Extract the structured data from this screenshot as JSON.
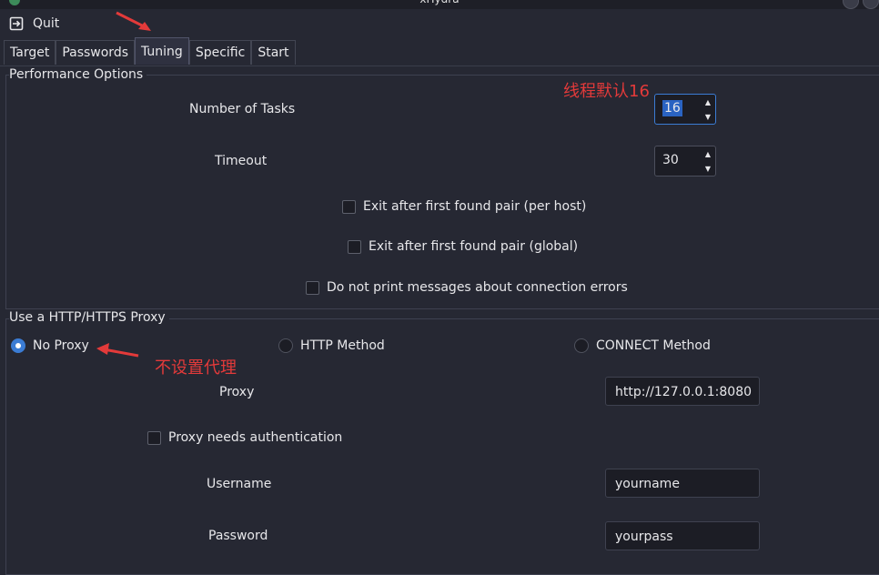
{
  "window": {
    "title": "xHydra"
  },
  "menu": {
    "quit_label": "Quit"
  },
  "tabs": [
    {
      "label": "Target"
    },
    {
      "label": "Passwords"
    },
    {
      "label": "Tuning"
    },
    {
      "label": "Specific"
    },
    {
      "label": "Start"
    }
  ],
  "performance": {
    "group_title": "Performance Options",
    "tasks_label": "Number of Tasks",
    "tasks_value": "16",
    "timeout_label": "Timeout",
    "timeout_value": "30",
    "exit_host_label": "Exit after first found pair (per host)",
    "exit_global_label": "Exit after first found pair (global)",
    "no_conn_errors_label": "Do not print messages about connection errors"
  },
  "proxy": {
    "group_title": "Use a HTTP/HTTPS Proxy",
    "no_proxy_label": "No Proxy",
    "http_method_label": "HTTP Method",
    "connect_method_label": "CONNECT Method",
    "proxy_label": "Proxy",
    "proxy_value": "http://127.0.0.1:8080",
    "auth_label": "Proxy needs authentication",
    "username_label": "Username",
    "username_value": "yourname",
    "password_label": "Password",
    "password_value": "yourpass"
  },
  "annotations": {
    "threads_note": "线程默认16",
    "no_proxy_note": "不设置代理",
    "color": "#e33a3a"
  }
}
